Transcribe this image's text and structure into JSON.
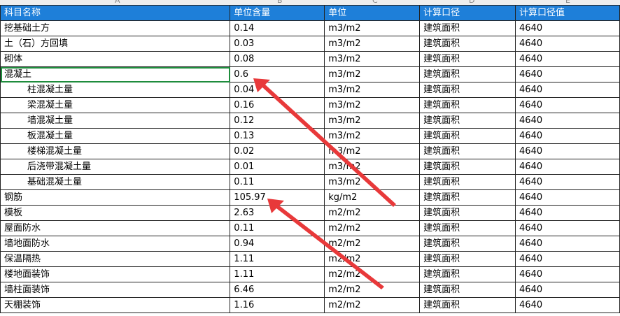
{
  "columns": {
    "letters": [
      "A",
      "B",
      "C",
      "D",
      "E"
    ]
  },
  "header": {
    "col1": "科目名称",
    "col2": "单位含量",
    "col3": "单位",
    "col4": "计算口径",
    "col5": "计算口径值"
  },
  "rows": [
    {
      "name": "挖基础土方",
      "qty": "0.14",
      "unit": "m3/m2",
      "basis": "建筑面积",
      "value": "4640"
    },
    {
      "name": "土（石）方回填",
      "qty": "0.03",
      "unit": "m3/m2",
      "basis": "建筑面积",
      "value": "4640"
    },
    {
      "name": "砌体",
      "qty": "0.08",
      "unit": "m3/m2",
      "basis": "建筑面积",
      "value": "4640"
    },
    {
      "name": "混凝土",
      "qty": "0.6",
      "unit": "m3/m2",
      "basis": "建筑面积",
      "value": "4640"
    },
    {
      "name": "柱混凝土量",
      "qty": "0.04",
      "unit": "m3/m2",
      "basis": "建筑面积",
      "value": "4640"
    },
    {
      "name": "梁混凝土量",
      "qty": "0.16",
      "unit": "m3/m2",
      "basis": "建筑面积",
      "value": "4640"
    },
    {
      "name": "墙混凝土量",
      "qty": "0.12",
      "unit": "m3/m2",
      "basis": "建筑面积",
      "value": "4640"
    },
    {
      "name": "板混凝土量",
      "qty": "0.13",
      "unit": "m3/m2",
      "basis": "建筑面积",
      "value": "4640"
    },
    {
      "name": "楼梯混凝土量",
      "qty": "0.02",
      "unit": "m3/m2",
      "basis": "建筑面积",
      "value": "4640"
    },
    {
      "name": "后浇带混凝土量",
      "qty": "0.01",
      "unit": "m3/m2",
      "basis": "建筑面积",
      "value": "4640"
    },
    {
      "name": "基础混凝土量",
      "qty": "0.11",
      "unit": "m3/m2",
      "basis": "建筑面积",
      "value": "4640"
    },
    {
      "name": "钢筋",
      "qty": "105.97",
      "unit": "kg/m2",
      "basis": "建筑面积",
      "value": "4640"
    },
    {
      "name": "模板",
      "qty": "2.63",
      "unit": "m2/m2",
      "basis": "建筑面积",
      "value": "4640"
    },
    {
      "name": "屋面防水",
      "qty": "0.11",
      "unit": "m2/m2",
      "basis": "建筑面积",
      "value": "4640"
    },
    {
      "name": "墙地面防水",
      "qty": "0.94",
      "unit": "m2/m2",
      "basis": "建筑面积",
      "value": "4640"
    },
    {
      "name": "保温隔热",
      "qty": "1.11",
      "unit": "m2/m2",
      "basis": "建筑面积",
      "value": "4640"
    },
    {
      "name": "楼地面装饰",
      "qty": "1.11",
      "unit": "m2/m2",
      "basis": "建筑面积",
      "value": "4640"
    },
    {
      "name": "墙柱面装饰",
      "qty": "6.46",
      "unit": "m2/m2",
      "basis": "建筑面积",
      "value": "4640"
    },
    {
      "name": "天棚装饰",
      "qty": "1.16",
      "unit": "m2/m2",
      "basis": "建筑面积",
      "value": "4640"
    }
  ],
  "colors": {
    "header_bg": "#1e7fd9",
    "selection": "#1e8c3c",
    "arrow": "#e8393a"
  }
}
